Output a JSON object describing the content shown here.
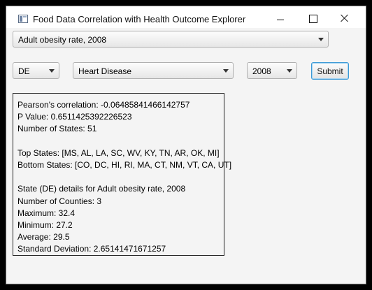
{
  "window": {
    "title": "Food Data Correlation with Health Outcome Explorer",
    "icon": "app-window-icon"
  },
  "controls": {
    "variable": "Adult obesity rate, 2008",
    "state": "DE",
    "outcome": "Heart Disease",
    "year": "2008",
    "submit_label": "Submit"
  },
  "results": {
    "correlation": "Pearson's correlation: -0.06485841466142757",
    "p_value": "P Value: 0.6511425392226523",
    "num_states": "Number of States: 51",
    "top_states": "Top States: [MS, AL, LA, SC, WV, KY, TN, AR, OK, MI]",
    "bottom_states": "Bottom States: [CO, DC, HI, RI, MA, CT, NM, VT, CA, UT]",
    "state_details": "State (DE) details for Adult obesity rate, 2008",
    "num_counties": "Number of Counties: 3",
    "maximum": "Maximum: 32.4",
    "minimum": "Minimum: 27.2",
    "average": "Average: 29.5",
    "std_dev": "Standard Deviation: 2.65141471671257"
  }
}
